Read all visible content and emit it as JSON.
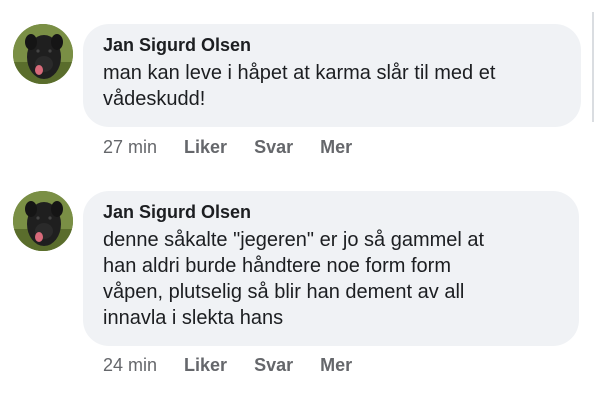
{
  "comments": [
    {
      "author": "Jan Sigurd Olsen",
      "text": "man kan leve i håpet at karma slår til med et\nvådeskudd!",
      "time": "27 min",
      "actions": {
        "like": "Liker",
        "reply": "Svar",
        "more": "Mer"
      }
    },
    {
      "author": "Jan Sigurd Olsen",
      "text": "denne såkalte \"jegeren\" er jo så gammel at\nhan aldri burde håndtere noe form form\nvåpen, plutselig så blir han dement av all\ninnavla i slekta hans",
      "time": "24 min",
      "actions": {
        "like": "Liker",
        "reply": "Svar",
        "more": "Mer"
      }
    }
  ],
  "colors": {
    "bubble_bg": "#f0f2f5",
    "text": "#1c1e21",
    "secondary": "#65676b"
  }
}
